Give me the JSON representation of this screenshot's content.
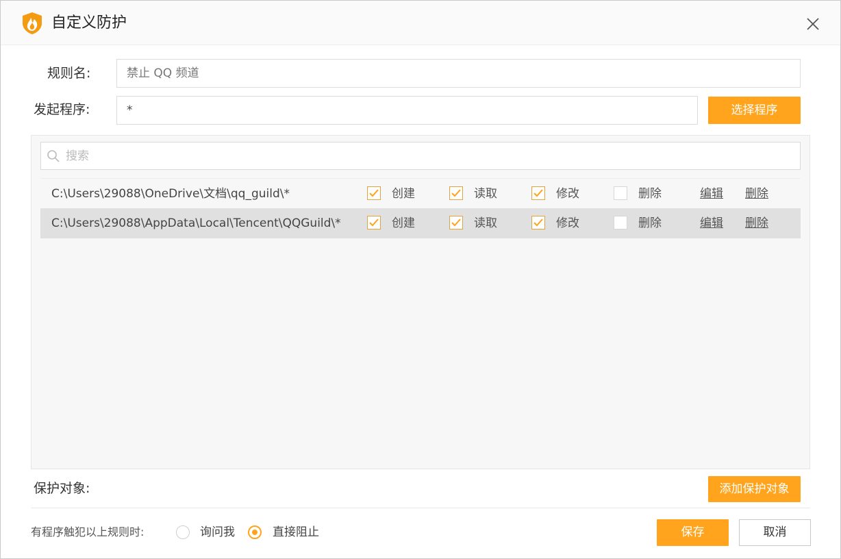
{
  "window": {
    "title": "自定义防护"
  },
  "form": {
    "rule_name_label": "规则名:",
    "rule_name_value": "禁止 QQ 频道",
    "program_label": "发起程序:",
    "program_value": "*",
    "select_program_button": "选择程序"
  },
  "search": {
    "placeholder": "搜索"
  },
  "rules": [
    {
      "path": "C:\\Users\\29088\\OneDrive\\文档\\qq_guild\\*",
      "create": {
        "label": "创建",
        "checked": true
      },
      "read": {
        "label": "读取",
        "checked": true
      },
      "modify": {
        "label": "修改",
        "checked": true
      },
      "delete": {
        "label": "删除",
        "checked": false
      },
      "edit_link": "编辑",
      "remove_link": "删除",
      "selected": false
    },
    {
      "path": "C:\\Users\\29088\\AppData\\Local\\Tencent\\QQGuild\\*",
      "create": {
        "label": "创建",
        "checked": true
      },
      "read": {
        "label": "读取",
        "checked": true
      },
      "modify": {
        "label": "修改",
        "checked": true
      },
      "delete": {
        "label": "删除",
        "checked": false
      },
      "edit_link": "编辑",
      "remove_link": "删除",
      "selected": true
    }
  ],
  "protect": {
    "label": "保护对象:",
    "add_button": "添加保护对象"
  },
  "trigger": {
    "label": "有程序触犯以上规则时:",
    "options": [
      {
        "label": "询问我",
        "selected": false
      },
      {
        "label": "直接阻止",
        "selected": true
      }
    ]
  },
  "footer": {
    "save": "保存",
    "cancel": "取消"
  },
  "colors": {
    "accent": "#ffa41c",
    "logo": "#f39c12"
  },
  "icons": {
    "logo": "flame-shield-icon",
    "close": "close-icon",
    "search": "search-icon",
    "check": "check-icon"
  }
}
